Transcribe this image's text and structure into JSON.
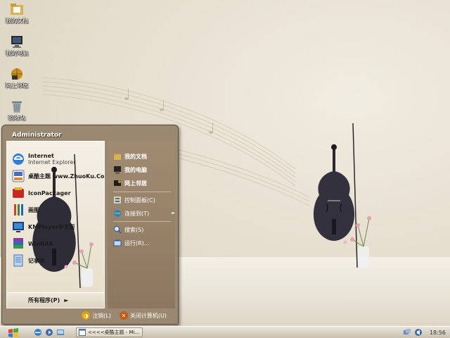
{
  "desktop": {
    "icons": [
      {
        "label": "我的文档",
        "icon": "my-documents-icon"
      },
      {
        "label": "我的电脑",
        "icon": "my-computer-icon"
      },
      {
        "label": "网上邻居",
        "icon": "network-places-icon"
      },
      {
        "label": "回收站",
        "icon": "recycle-bin-icon"
      }
    ]
  },
  "start_menu": {
    "user": "Administrator",
    "programs": [
      {
        "title": "Internet",
        "subtitle": "Internet Explorer",
        "icon": "internet-explorer-icon"
      },
      {
        "title": "桌酷主题 www.ZhuoKu.Com",
        "icon": "zhuoku-icon"
      },
      {
        "title": "IconPackager",
        "icon": "iconpackager-icon"
      },
      {
        "title": "画图",
        "icon": "paint-icon"
      },
      {
        "title": "KMPlayer中文版",
        "icon": "kmplayer-icon"
      },
      {
        "title": "WinRAR",
        "icon": "winrar-icon"
      },
      {
        "title": "记事本",
        "icon": "notepad-icon"
      }
    ],
    "all_programs": "所有程序(P)",
    "places": [
      {
        "label": "我的文档"
      },
      {
        "label": "我的电脑"
      },
      {
        "label": "网上邻居"
      }
    ],
    "system": [
      {
        "label": "控制面板(C)"
      },
      {
        "label": "连接到(T)"
      }
    ],
    "tools": [
      {
        "label": "搜索(S)"
      },
      {
        "label": "运行(R)..."
      }
    ],
    "logoff": "注销(L)",
    "shutdown": "关闭计算机(U)"
  },
  "taskbar": {
    "task_title": "<<<<桌酷主题 - Mi...",
    "clock": "18:56"
  },
  "colors": {
    "menu_frame": "#9b8870",
    "menu_right": "#8c7760",
    "taskbar": "#d6cdbd",
    "logoff_icon": "#e0a000",
    "shutdown_icon": "#c45a10"
  }
}
